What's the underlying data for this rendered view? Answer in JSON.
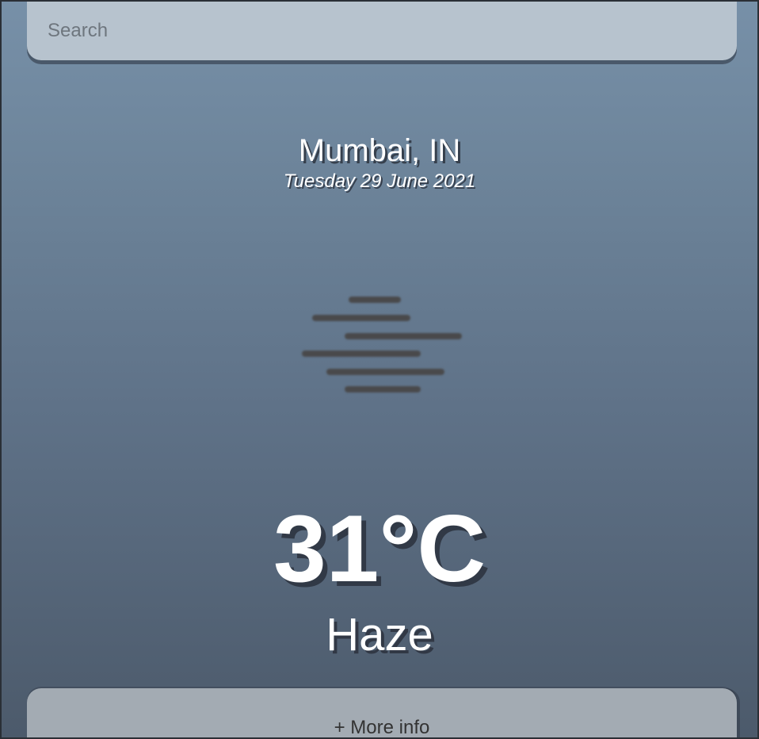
{
  "search": {
    "placeholder": "Search"
  },
  "location": {
    "name": "Mumbai, IN",
    "date": "Tuesday 29 June 2021"
  },
  "weather": {
    "temperature": "31°C",
    "condition": "Haze",
    "icon": "haze-icon"
  },
  "more_info": {
    "label": "+ More info"
  },
  "colors": {
    "background_top": "#7790a8",
    "background_bottom": "#4c5a6b",
    "search_bg": "#b7c3ce",
    "more_info_bg": "#a3abb3",
    "icon_color": "#4a4a4c"
  }
}
